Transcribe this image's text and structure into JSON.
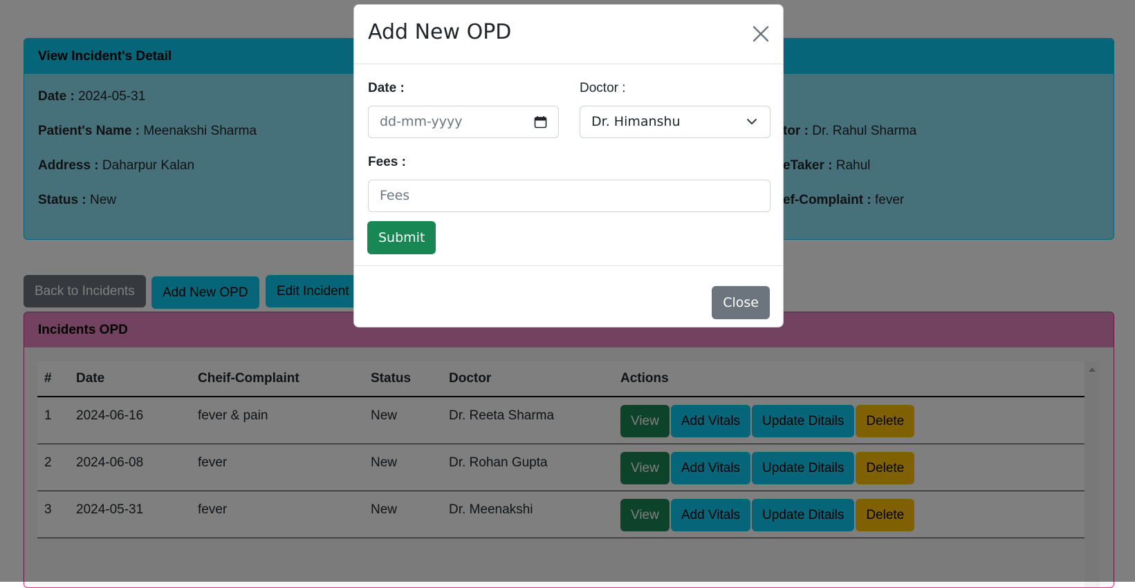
{
  "colors": {
    "info": "#0dcaf0",
    "success": "#198754",
    "secondary": "#6c757d",
    "warning": "#ffc107",
    "pink": "#e685c1"
  },
  "detail": {
    "header": "View Incident's Detail",
    "date_label": "Date :",
    "date_value": "2024-05-31",
    "patient_label": "Patient's Name :",
    "patient_value": "Meenakshi Sharma",
    "address_label": "Address :",
    "address_value": "Daharpur Kalan",
    "status_label": "Status :",
    "status_value": "New",
    "doctor_label": "tor :",
    "doctor_value": "Dr. Rahul Sharma",
    "caretaker_label": "eTaker :",
    "caretaker_value": "Rahul",
    "complaint_label": "ef-Complaint :",
    "complaint_value": "fever"
  },
  "buttons": {
    "back": "Back to Incidents",
    "add_opd": "Add New OPD",
    "edit": "Edit Incident"
  },
  "opd": {
    "header": "Incidents OPD",
    "columns": [
      "#",
      "Date",
      "Cheif-Complaint",
      "Status",
      "Doctor",
      "Actions"
    ],
    "rows": [
      {
        "num": "1",
        "date": "2024-06-16",
        "complaint": "fever & pain",
        "status": "New",
        "doctor": "Dr. Reeta Sharma"
      },
      {
        "num": "2",
        "date": "2024-06-08",
        "complaint": "fever",
        "status": "New",
        "doctor": "Dr. Rohan Gupta"
      },
      {
        "num": "3",
        "date": "2024-05-31",
        "complaint": "fever",
        "status": "New",
        "doctor": "Dr. Meenakshi"
      }
    ],
    "actions": {
      "view": "View",
      "vitals": "Add Vitals",
      "update": "Update Ditails",
      "delete": "Delete"
    }
  },
  "modal": {
    "title": "Add New OPD",
    "date_label": "Date :",
    "date_placeholder": "dd-mm-yyyy",
    "doctor_label": "Doctor :",
    "doctor_selected": "Dr. Himanshu",
    "fees_label": "Fees :",
    "fees_placeholder": "Fees",
    "submit": "Submit",
    "close": "Close",
    "icons": {
      "close": "close-icon",
      "calendar": "calendar-icon",
      "chevron": "chevron-down-icon"
    }
  }
}
